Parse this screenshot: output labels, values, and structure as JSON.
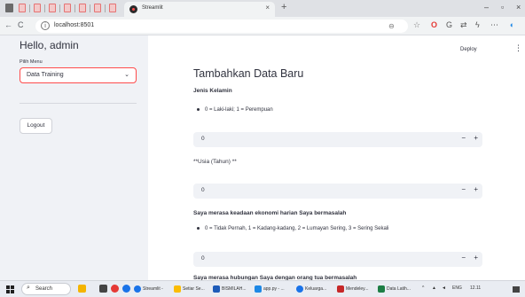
{
  "browser": {
    "active_tab_title": "Streamlit",
    "url": "localhost:8501",
    "new_tab_icon": "plus-icon",
    "info_icon": "i"
  },
  "sidebar": {
    "greeting": "Hello, admin",
    "menu_label": "Pilih Menu",
    "menu_selected": "Data Training",
    "logout_label": "Logout"
  },
  "header": {
    "deploy_label": "Deploy"
  },
  "main": {
    "title": "Tambahkan Data Baru",
    "gender_heading": "Jenis Kelamin",
    "gender_legend": "0 = Laki-laki; 1 = Perempuan",
    "gender_value": "0",
    "age_label": "**Usia (Tahun) **",
    "age_value": "0",
    "q1_label": "Saya merasa keadaan ekonomi harian Saya bermasalah",
    "q1_legend": "0 = Tidak Pernah, 1 = Kadang-kadang, 2 = Lumayan Sering, 3 = Sering Sekali",
    "q1_value": "0",
    "q2_label": "Saya merasa hubungan Saya dengan orang tua bermasalah"
  },
  "stepper": {
    "minus": "−",
    "plus": "+"
  },
  "taskbar": {
    "search_label": "Search",
    "apps": [
      "Streamlit - ...",
      "Setiar Se...",
      "BISMILAH...",
      "app.py - ...",
      "Keluarga...",
      "Mendeley...",
      "Data Latih..."
    ],
    "lang": "ENG",
    "time": "12.11"
  },
  "colors": {
    "accent": "#ff4b4b",
    "sidebar_bg": "#f0f2f6",
    "text": "#31333f"
  }
}
